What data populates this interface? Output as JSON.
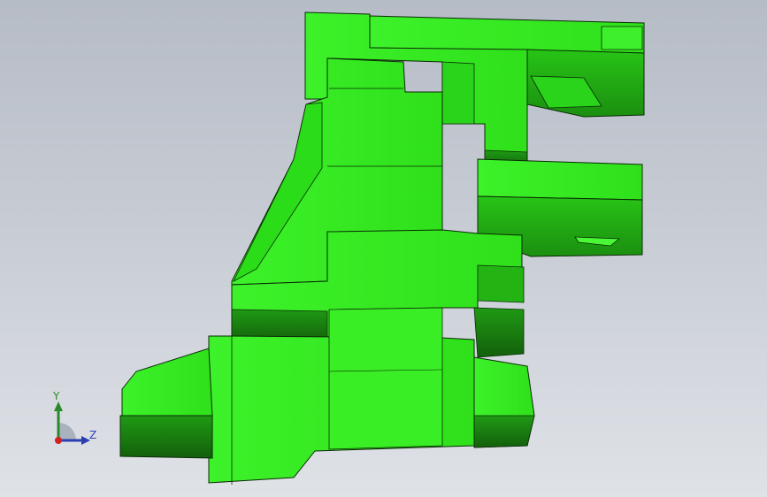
{
  "viewport": {
    "background_top": "#b6bcc6",
    "background_bottom": "#dfe2e7"
  },
  "model": {
    "part_color": "#33ee1c",
    "part_shadow": "#1a8a12",
    "edge_color": "#0a2a06"
  },
  "triad": {
    "y_label": "Y",
    "z_label": "Z",
    "y_axis_color": "#2a8a2a",
    "z_axis_color": "#2b3fb0",
    "origin_color": "#d42020",
    "x_axis_plane_icon": "axis-plane-icon"
  }
}
